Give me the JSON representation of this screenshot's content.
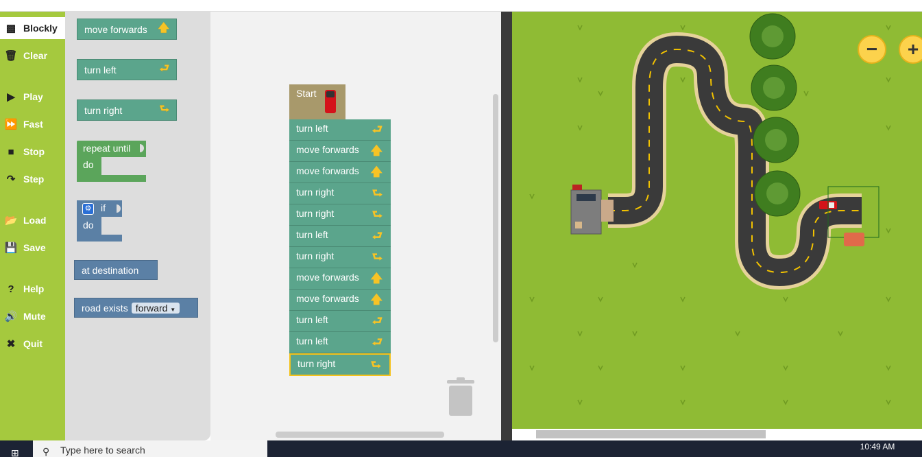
{
  "sidebar": {
    "items": [
      {
        "label": "Blockly",
        "icon": "blockly-icon"
      },
      {
        "label": "Clear",
        "icon": "trash-icon"
      },
      {
        "label": "Play",
        "icon": "play-icon"
      },
      {
        "label": "Fast",
        "icon": "fast-forward-icon"
      },
      {
        "label": "Stop",
        "icon": "stop-icon"
      },
      {
        "label": "Step",
        "icon": "step-icon"
      },
      {
        "label": "Load",
        "icon": "folder-icon"
      },
      {
        "label": "Save",
        "icon": "floppy-icon"
      },
      {
        "label": "Help",
        "icon": "question-icon"
      },
      {
        "label": "Mute",
        "icon": "speaker-icon"
      },
      {
        "label": "Quit",
        "icon": "close-icon"
      }
    ]
  },
  "toolbox": {
    "move_forwards": "move forwards",
    "turn_left": "turn left",
    "turn_right": "turn right",
    "repeat_until": "repeat until",
    "repeat_do": "do",
    "if_label": "if",
    "if_do": "do",
    "at_destination": "at destination",
    "road_exists": "road exists",
    "road_exists_option": "forward"
  },
  "program": {
    "start_label": "Start",
    "blocks": [
      {
        "label": "turn left",
        "dir": "left"
      },
      {
        "label": "move forwards",
        "dir": "up"
      },
      {
        "label": "move forwards",
        "dir": "up"
      },
      {
        "label": "turn right",
        "dir": "right"
      },
      {
        "label": "turn right",
        "dir": "right"
      },
      {
        "label": "turn left",
        "dir": "left"
      },
      {
        "label": "turn right",
        "dir": "right"
      },
      {
        "label": "move forwards",
        "dir": "up"
      },
      {
        "label": "move forwards",
        "dir": "up"
      },
      {
        "label": "turn left",
        "dir": "left"
      },
      {
        "label": "turn left",
        "dir": "left"
      },
      {
        "label": "turn right",
        "dir": "right"
      }
    ]
  },
  "map": {
    "zoom_out": "−",
    "zoom_in": "+"
  },
  "taskbar": {
    "search_placeholder": "Type here to search",
    "time": "10:49 AM"
  },
  "colors": {
    "sidebar": "#a5c93e",
    "action_block": "#5ba58c",
    "logic_block": "#5b80a5",
    "grass": "#8fbb34",
    "selected_outline": "#f5c21b"
  }
}
